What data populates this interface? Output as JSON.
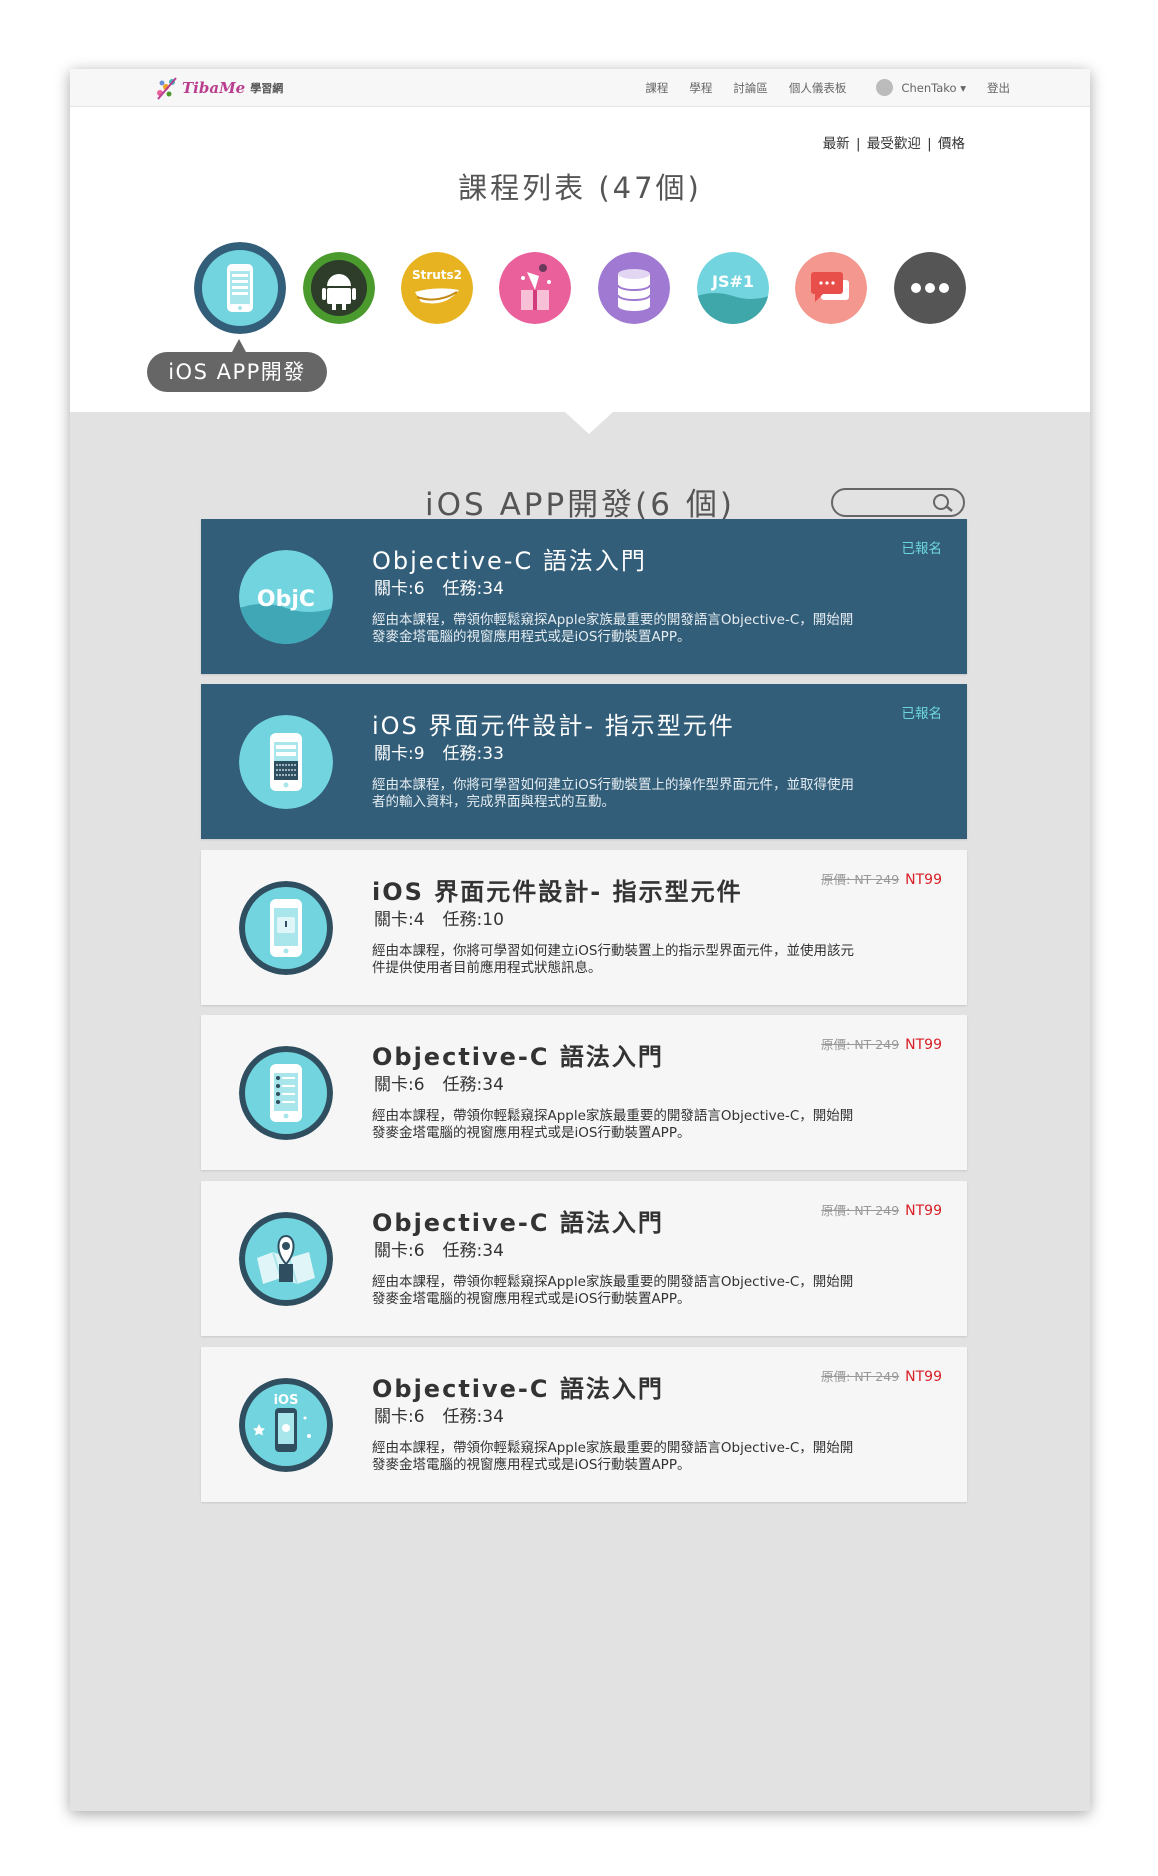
{
  "brand": {
    "name": "TibaMe",
    "subtitle": "學習網"
  },
  "nav": {
    "items": [
      "課程",
      "學程",
      "討論區",
      "個人儀表板"
    ],
    "user": "ChenTako ▾",
    "logout": "登出"
  },
  "sort": {
    "newest": "最新",
    "popular": "最受歡迎",
    "price": "價格",
    "separator": "|"
  },
  "page_title": "課程列表 (47個)",
  "categories": [
    {
      "name": "ios-category-icon",
      "color": "#72d4de"
    },
    {
      "name": "android-category-icon",
      "color": "#4b9a2e"
    },
    {
      "name": "struts2-category-icon",
      "label": "Struts2",
      "color": "#e8b321"
    },
    {
      "name": "gift-category-icon",
      "color": "#e9609a"
    },
    {
      "name": "database-category-icon",
      "color": "#a07ad2"
    },
    {
      "name": "javascript-category-icon",
      "label": "JS#1",
      "color": "#3fb3b5"
    },
    {
      "name": "chat-category-icon",
      "label": "...",
      "color": "#f4978e"
    },
    {
      "name": "more-category-icon",
      "label": "•••",
      "color": "#555555"
    }
  ],
  "active_category_label": "iOS APP開發",
  "section_title": "iOS APP開發(6 個)",
  "search": {
    "placeholder": ""
  },
  "courses": [
    {
      "title": "Objective-C 語法入門",
      "levels": "關卡:6",
      "tasks": "任務:34",
      "desc1": "經由本課程，帶領你輕鬆窺探Apple家族最重要的開發語言Objective-C，開始開",
      "desc2": "發麥金塔電腦的視窗應用程式或是iOS行動裝置APP。",
      "status": "已報名",
      "icon": "objc-icon",
      "icon_label": "ObjC"
    },
    {
      "title": "iOS 界面元件設計- 指示型元件",
      "levels": "關卡:9",
      "tasks": "任務:33",
      "desc1": "經由本課程，你將可學習如何建立iOS行動裝置上的操作型界面元件，並取得使用",
      "desc2": "者的輸入資料，完成界面與程式的互動。",
      "status": "已報名",
      "icon": "phone-keyboard-icon"
    },
    {
      "title": "iOS 界面元件設計- 指示型元件",
      "levels": "關卡:4",
      "tasks": "任務:10",
      "desc1": "經由本課程，你將可學習如何建立iOS行動裝置上的指示型界面元件，並使用該元",
      "desc2": "件提供使用者目前應用程式狀態訊息。",
      "original_price": "原價: NT 249",
      "price": "NT99",
      "icon": "phone-indicator-icon"
    },
    {
      "title": "Objective-C 語法入門",
      "levels": "關卡:6",
      "tasks": "任務:34",
      "desc1": "經由本課程，帶領你輕鬆窺探Apple家族最重要的開發語言Objective-C，開始開",
      "desc2": "發麥金塔電腦的視窗應用程式或是iOS行動裝置APP。",
      "original_price": "原價: NT 249",
      "price": "NT99",
      "icon": "phone-list-icon"
    },
    {
      "title": "Objective-C 語法入門",
      "levels": "關卡:6",
      "tasks": "任務:34",
      "desc1": "經由本課程，帶領你輕鬆窺探Apple家族最重要的開發語言Objective-C，開始開",
      "desc2": "發麥金塔電腦的視窗應用程式或是iOS行動裝置APP。",
      "original_price": "原價: NT 249",
      "price": "NT99",
      "icon": "map-pin-icon"
    },
    {
      "title": "Objective-C 語法入門",
      "levels": "關卡:6",
      "tasks": "任務:34",
      "desc1": "經由本課程，帶領你輕鬆窺探Apple家族最重要的開發語言Objective-C，開始開",
      "desc2": "發麥金塔電腦的視窗應用程式或是iOS行動裝置APP。",
      "original_price": "原價: NT 249",
      "price": "NT99",
      "icon": "ios-phone-icon",
      "icon_label": "iOS"
    }
  ]
}
